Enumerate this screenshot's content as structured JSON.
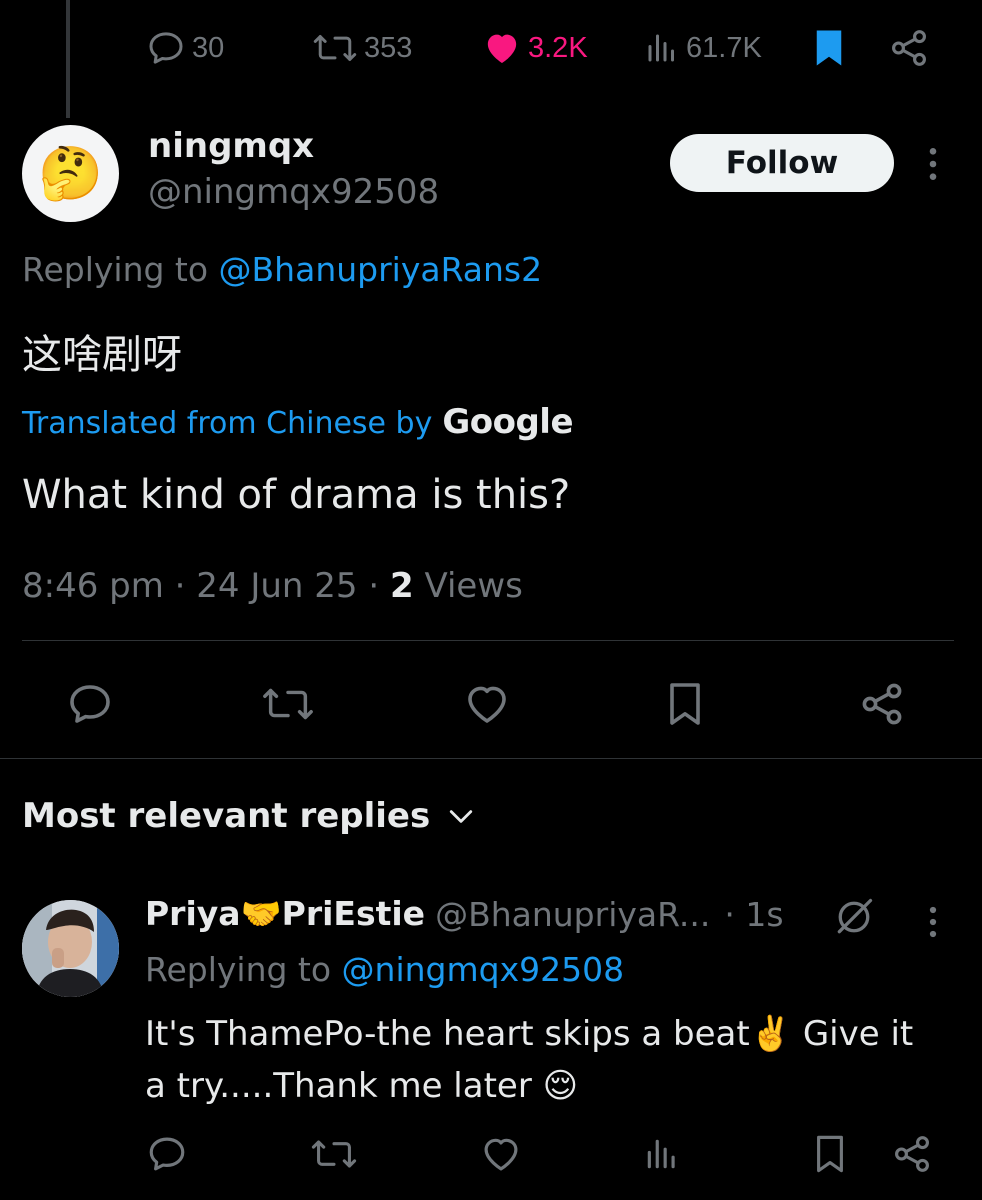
{
  "top_stats": {
    "replies": "30",
    "reposts": "353",
    "likes": "3.2K",
    "views": "61.7K"
  },
  "post": {
    "display_name": "ningmqx",
    "handle": "@ningmqx92508",
    "avatar_emoji": "🤔",
    "follow_label": "Follow",
    "replying_prefix": "Replying to ",
    "replying_to": "@BhanupriyaRans2",
    "original_text": "这啥剧呀",
    "translated_prefix": "Translated from Chinese by",
    "translated_by": "Google",
    "translation": "What kind of drama is this?",
    "time": "8:46 pm · 24 Jun 25 · ",
    "views_count": "2",
    "views_label": " Views"
  },
  "replies_header": {
    "label": "Most relevant replies"
  },
  "reply": {
    "display_name": "Priya🤝PriEstie",
    "handle": "@BhanupriyaR...",
    "time": "· 1s",
    "replying_prefix": "Replying to ",
    "replying_to": "@ningmqx92508",
    "text_line1": "It's ThamePo-the heart skips a beat✌️ Give it",
    "text_line2": "a try.....Thank me later 😌"
  },
  "colors": {
    "background": "#000000",
    "text": "#e7e9ea",
    "secondary": "#71767b",
    "accent_blue": "#1d9bf0",
    "like_pink": "#f91880",
    "divider": "#2f3336"
  },
  "icons": [
    "reply-icon",
    "repost-icon",
    "heart-icon",
    "views-icon",
    "bookmark-icon",
    "share-icon",
    "more-icon",
    "chevron-down-icon",
    "mute-icon"
  ]
}
